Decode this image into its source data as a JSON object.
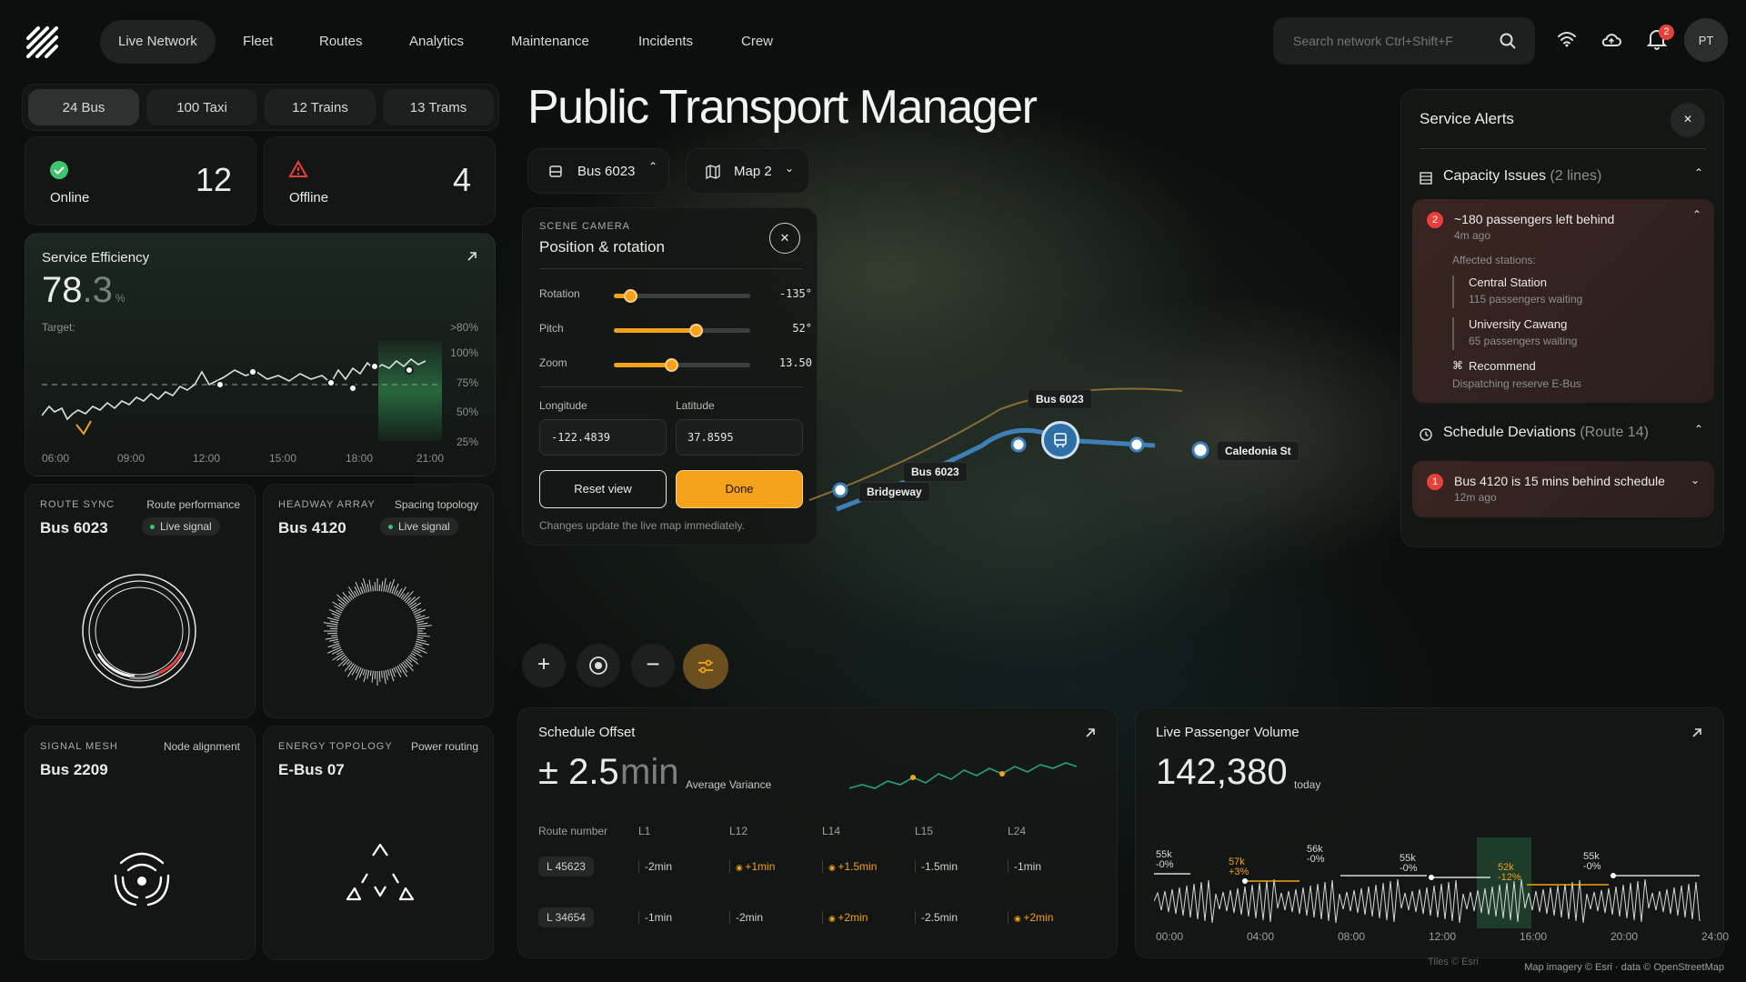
{
  "nav": {
    "items": [
      "Live Network",
      "Fleet",
      "Routes",
      "Analytics",
      "Maintenance",
      "Incidents",
      "Crew"
    ],
    "active": "Live Network"
  },
  "search": {
    "placeholder": "Search network Ctrl+Shift+F"
  },
  "header": {
    "notif_count": "2",
    "avatar_initials": "PT"
  },
  "title": "Public Transport Manager",
  "vehicle_tabs": [
    "24 Bus",
    "100 Taxi",
    "12 Trains",
    "13 Trams"
  ],
  "status": {
    "online_label": "Online",
    "online_count": "12",
    "offline_label": "Offline",
    "offline_count": "4"
  },
  "efficiency": {
    "title": "Service Efficiency",
    "value_int": "78",
    "value_dec": ".3",
    "unit": "%",
    "target_label": "Target:",
    "target_value": ">80%",
    "y_ticks": [
      "100%",
      "75%",
      "50%",
      "25%"
    ],
    "x_ticks": [
      "06:00",
      "09:00",
      "12:00",
      "15:00",
      "18:00",
      "21:00"
    ]
  },
  "mini_cards": [
    {
      "tag": "ROUTE SYNC",
      "sub": "Route performance",
      "name": "Bus 6023",
      "badge": "Live signal"
    },
    {
      "tag": "HEADWAY ARRAY",
      "sub": "Spacing topology",
      "name": "Bus 4120",
      "badge": "Live signal"
    },
    {
      "tag": "SIGNAL MESH",
      "sub": "Node alignment",
      "name": "Bus 2209"
    },
    {
      "tag": "ENERGY TOPOLOGY",
      "sub": "Power routing",
      "name": "E-Bus 07"
    }
  ],
  "toolbar": {
    "vehicle_select": "Bus 6023",
    "map_select": "Map 2"
  },
  "camera": {
    "tag": "SCENE CAMERA",
    "title": "Position & rotation",
    "rotation_label": "Rotation",
    "rotation_value": "-135°",
    "rotation_level": 0.12,
    "pitch_label": "Pitch",
    "pitch_value": "52°",
    "pitch_level": 0.6,
    "zoom_label": "Zoom",
    "zoom_value": "13.50",
    "zoom_level": 0.42,
    "lon_label": "Longitude",
    "lon_value": "-122.4839",
    "lat_label": "Latitude",
    "lat_value": "37.8595",
    "reset_label": "Reset view",
    "done_label": "Done",
    "note": "Changes update the live map immediately."
  },
  "map": {
    "labels": {
      "bus_top": "Bus 6023",
      "bus_bottom": "Bus 6023",
      "bridgeway": "Bridgeway",
      "caledonia": "Caledonia St"
    },
    "attribution": "Map imagery © Esri · data © OpenStreetMap",
    "tiles": "Tiles © Esri"
  },
  "alerts": {
    "title": "Service Alerts",
    "capacity_title": "Capacity Issues",
    "capacity_count": "(2 lines)",
    "item1_badge": "2",
    "item1_title": "~180 passengers left behind",
    "item1_time": "4m ago",
    "affected_label": "Affected stations:",
    "stations": [
      {
        "name": "Central Station",
        "detail": "115 passengers waiting"
      },
      {
        "name": "University Cawang",
        "detail": "65 passengers waiting"
      }
    ],
    "recommend_label": "Recommend",
    "recommend_detail": "Dispatching reserve E-Bus",
    "deviation_title": "Schedule Deviations",
    "deviation_route": "(Route 14)",
    "item2_badge": "1",
    "item2_title": "Bus 4120 is 15 mins behind schedule",
    "item2_time": "12m ago"
  },
  "offset": {
    "title": "Schedule Offset",
    "value": "± 2.5",
    "unit": "min",
    "caption": "Average Variance",
    "headers": [
      "Route number",
      "L1",
      "L12",
      "L14",
      "L15",
      "L24"
    ],
    "rows": [
      [
        "L 45623",
        "-2min",
        "+1min",
        "+1.5min",
        "-1.5min",
        "-1min"
      ],
      [
        "L 34654",
        "-1min",
        "-2min",
        "+2min",
        "-2.5min",
        "+2min"
      ]
    ]
  },
  "volume": {
    "title": "Live Passenger Volume",
    "value": "142,380",
    "caption": "today",
    "x_ticks": [
      "00:00",
      "04:00",
      "08:00",
      "12:00",
      "16:00",
      "20:00",
      "24:00"
    ],
    "annotations": [
      {
        "v": "55k",
        "d": "-0%"
      },
      {
        "v": "57k",
        "d": "+3%"
      },
      {
        "v": "56k",
        "d": "-0%"
      },
      {
        "v": "55k",
        "d": "-0%"
      },
      {
        "v": "52k",
        "d": "-12%"
      },
      {
        "v": "55k",
        "d": "-0%"
      }
    ]
  },
  "colors": {
    "accent": "#f4a21a",
    "online": "#3ec46d",
    "offline": "#e8413c",
    "map_route": "#3f7fb8"
  }
}
